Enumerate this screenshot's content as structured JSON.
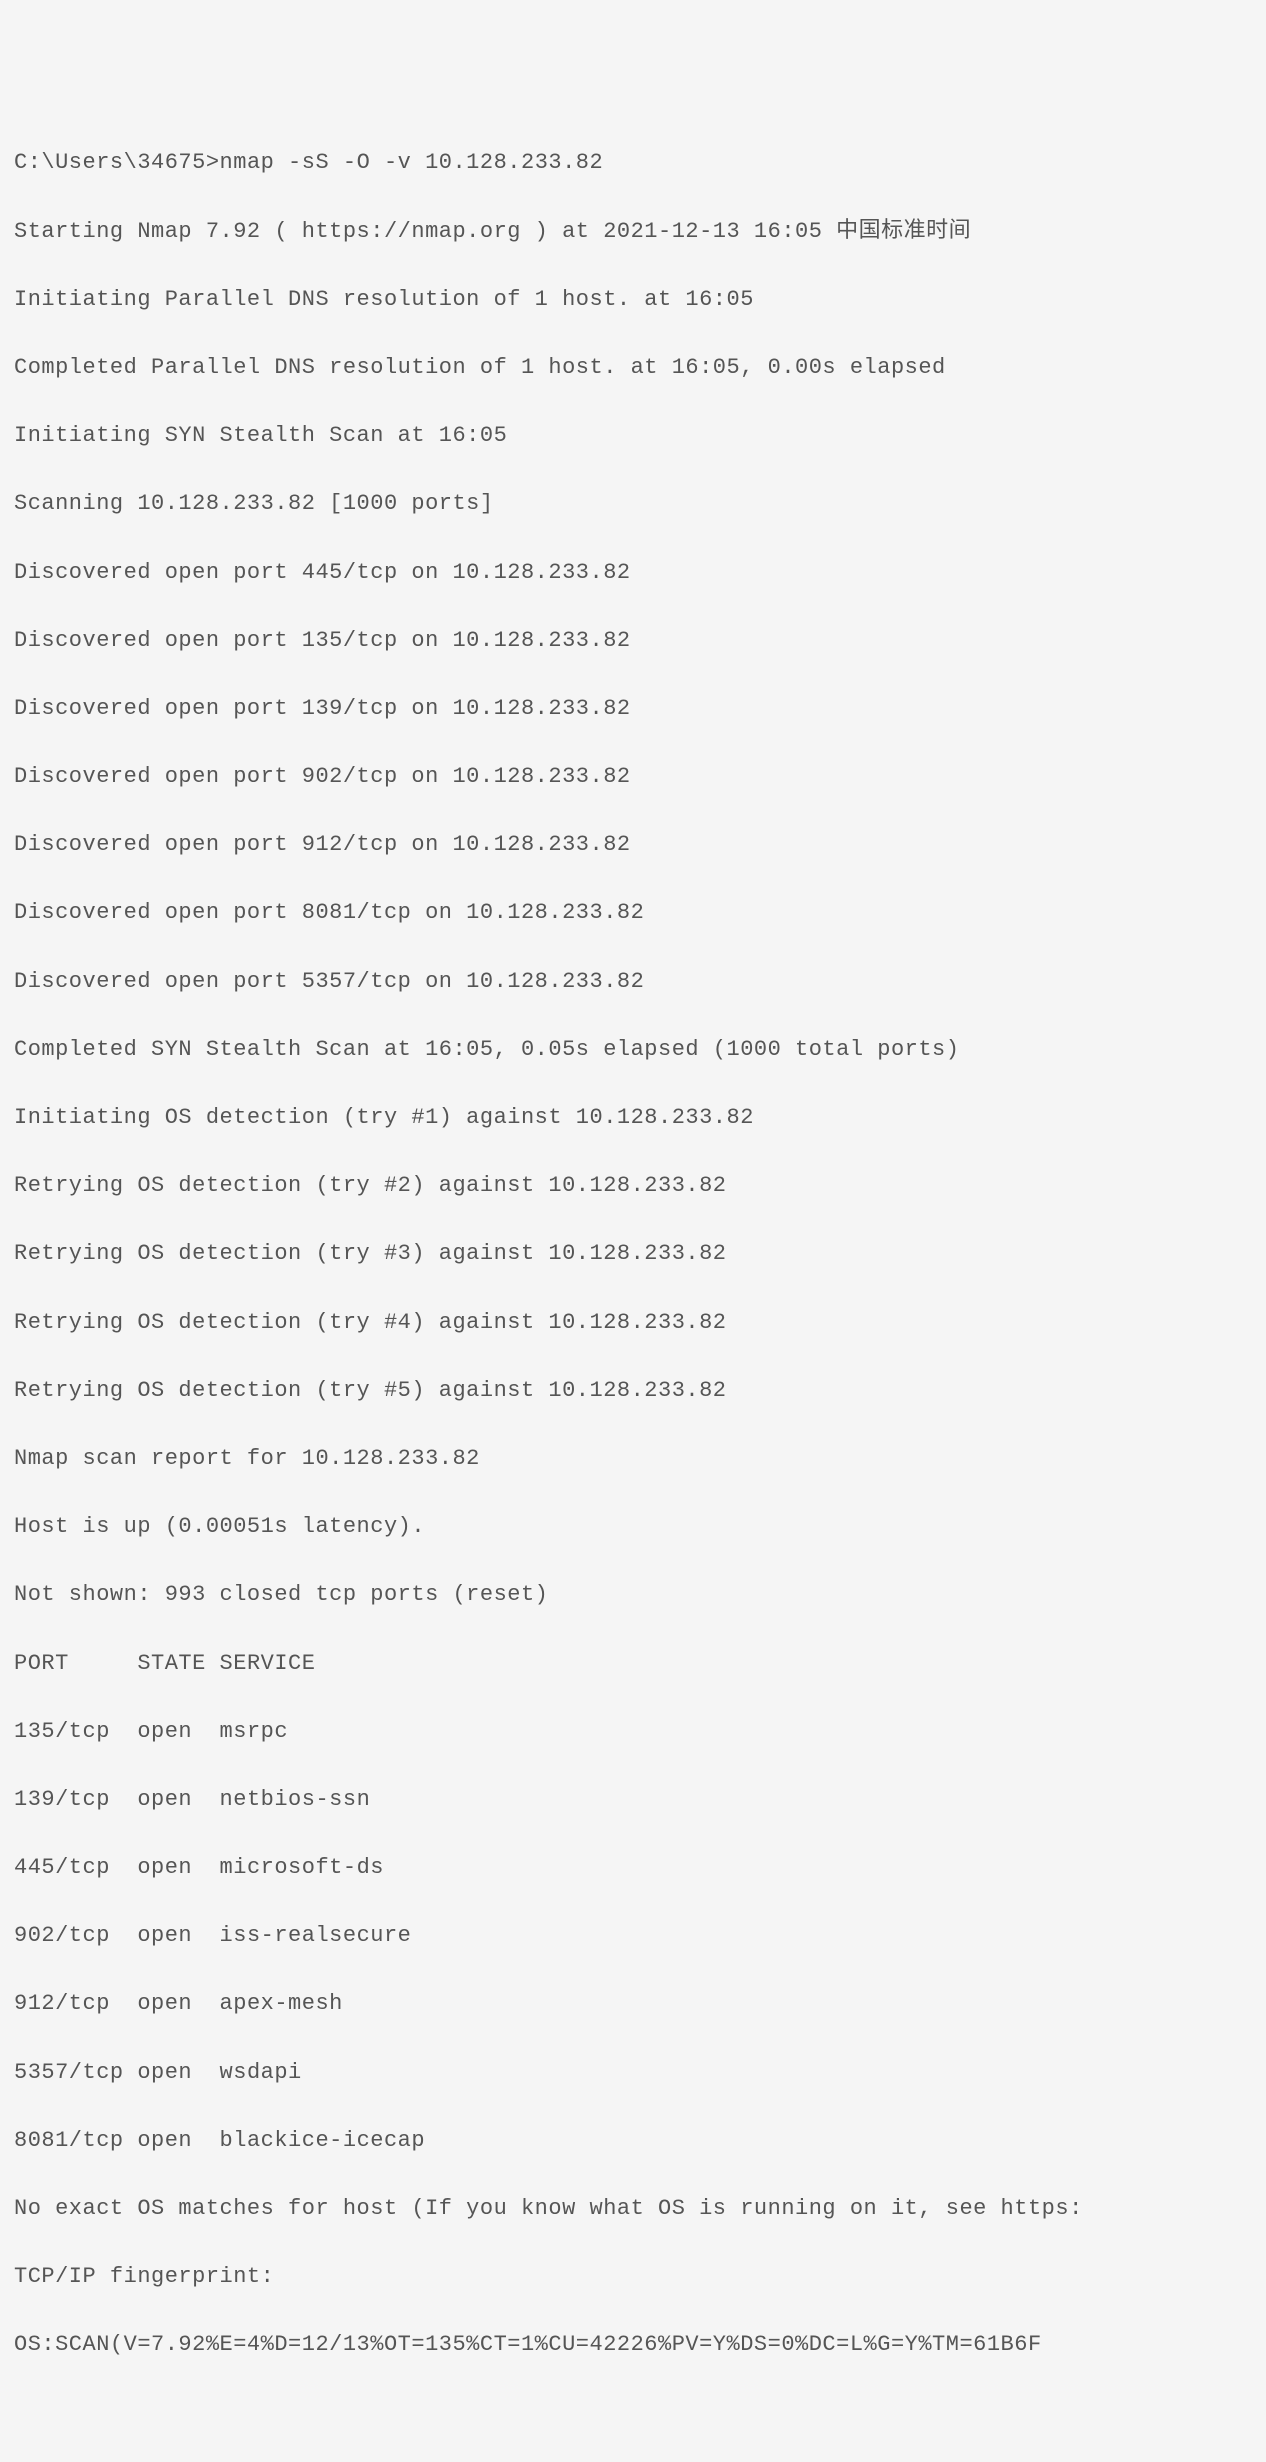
{
  "terminal": {
    "prompt": "C:\\Users\\34675>",
    "command": "nmap -sS -O -v 10.128.233.82",
    "lines": [
      "Starting Nmap 7.92 ( https://nmap.org ) at 2021-12-13 16:05 中国标准时间",
      "Initiating Parallel DNS resolution of 1 host. at 16:05",
      "Completed Parallel DNS resolution of 1 host. at 16:05, 0.00s elapsed",
      "Initiating SYN Stealth Scan at 16:05",
      "Scanning 10.128.233.82 [1000 ports]",
      "Discovered open port 445/tcp on 10.128.233.82",
      "Discovered open port 135/tcp on 10.128.233.82",
      "Discovered open port 139/tcp on 10.128.233.82",
      "Discovered open port 902/tcp on 10.128.233.82",
      "Discovered open port 912/tcp on 10.128.233.82",
      "Discovered open port 8081/tcp on 10.128.233.82",
      "Discovered open port 5357/tcp on 10.128.233.82",
      "Completed SYN Stealth Scan at 16:05, 0.05s elapsed (1000 total ports)",
      "Initiating OS detection (try #1) against 10.128.233.82",
      "Retrying OS detection (try #2) against 10.128.233.82",
      "Retrying OS detection (try #3) against 10.128.233.82",
      "Retrying OS detection (try #4) against 10.128.233.82",
      "Retrying OS detection (try #5) against 10.128.233.82",
      "Nmap scan report for 10.128.233.82",
      "Host is up (0.00051s latency).",
      "Not shown: 993 closed tcp ports (reset)"
    ],
    "table": {
      "header": {
        "port": "PORT",
        "state": "STATE",
        "service": "SERVICE"
      },
      "rows": [
        {
          "port": "135/tcp",
          "state": "open",
          "service": "msrpc"
        },
        {
          "port": "139/tcp",
          "state": "open",
          "service": "netbios-ssn"
        },
        {
          "port": "445/tcp",
          "state": "open",
          "service": "microsoft-ds"
        },
        {
          "port": "902/tcp",
          "state": "open",
          "service": "iss-realsecure"
        },
        {
          "port": "912/tcp",
          "state": "open",
          "service": "apex-mesh"
        },
        {
          "port": "5357/tcp",
          "state": "open",
          "service": "wsdapi"
        },
        {
          "port": "8081/tcp",
          "state": "open",
          "service": "blackice-icecap"
        }
      ]
    },
    "footer": [
      "No exact OS matches for host (If you know what OS is running on it, see https:",
      "TCP/IP fingerprint:",
      "OS:SCAN(V=7.92%E=4%D=12/13%OT=135%CT=1%CU=42226%PV=Y%DS=0%DC=L%G=Y%TM=61B6F"
    ]
  }
}
